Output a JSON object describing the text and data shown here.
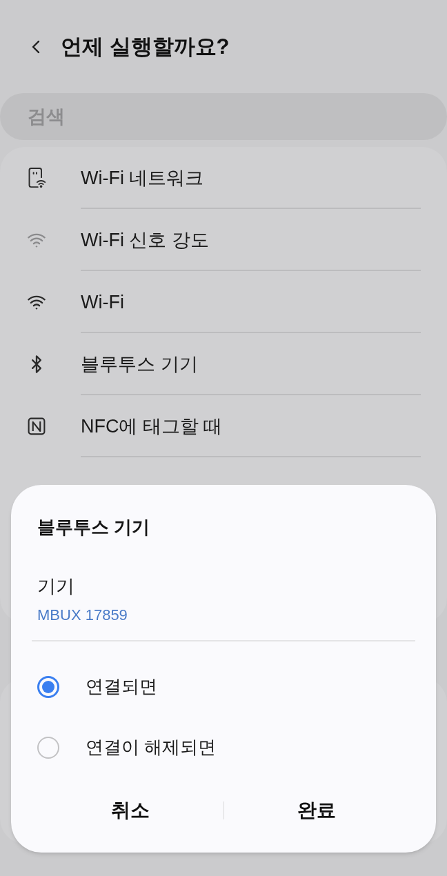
{
  "header": {
    "title": "언제 실행할까요?"
  },
  "search": {
    "placeholder": "검색"
  },
  "items": [
    {
      "kind": "wifi-network",
      "label": "Wi-Fi 네트워크"
    },
    {
      "kind": "wifi-signal",
      "label": "Wi-Fi 신호 강도"
    },
    {
      "kind": "wifi",
      "label": "Wi-Fi"
    },
    {
      "kind": "bluetooth",
      "label": "블루투스 기기"
    },
    {
      "kind": "nfc",
      "label": "NFC에 태그할 때"
    }
  ],
  "dialog": {
    "title": "블루투스 기기",
    "device_label": "기기",
    "device_value": "MBUX 17859",
    "options": [
      {
        "label": "연결되면",
        "selected": true
      },
      {
        "label": "연결이 해제되면",
        "selected": false
      }
    ],
    "buttons": [
      "취소",
      "완료"
    ]
  }
}
